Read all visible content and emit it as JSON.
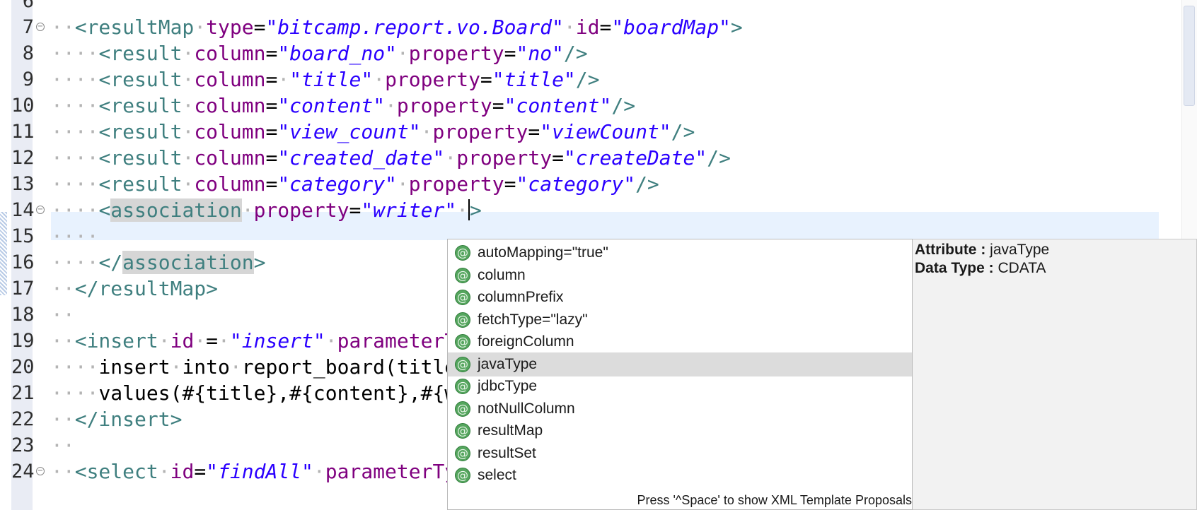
{
  "editor": {
    "lines": [
      {
        "no": "6",
        "fold": false,
        "tokens": []
      },
      {
        "no": "7",
        "fold": true,
        "tokens": [
          [
            "ws",
            "··"
          ],
          [
            "tag",
            "<resultMap"
          ],
          [
            "ws",
            "·"
          ],
          [
            "an",
            "type"
          ],
          [
            "eq",
            "="
          ],
          [
            "av",
            "\"bitcamp.report.vo.Board\""
          ],
          [
            "ws",
            "·"
          ],
          [
            "an",
            "id"
          ],
          [
            "eq",
            "="
          ],
          [
            "av",
            "\"boardMap\""
          ],
          [
            "tag",
            ">"
          ]
        ]
      },
      {
        "no": "8",
        "fold": false,
        "tokens": [
          [
            "ws",
            "····"
          ],
          [
            "tag",
            "<result"
          ],
          [
            "ws",
            "·"
          ],
          [
            "an",
            "column"
          ],
          [
            "eq",
            "="
          ],
          [
            "av",
            "\"board_no\""
          ],
          [
            "ws",
            "·"
          ],
          [
            "an",
            "property"
          ],
          [
            "eq",
            "="
          ],
          [
            "av",
            "\"no\""
          ],
          [
            "tag",
            "/>"
          ]
        ]
      },
      {
        "no": "9",
        "fold": false,
        "tokens": [
          [
            "ws",
            "····"
          ],
          [
            "tag",
            "<result"
          ],
          [
            "ws",
            "·"
          ],
          [
            "an",
            "column"
          ],
          [
            "eq",
            "="
          ],
          [
            "ws",
            "·"
          ],
          [
            "av",
            "\"title\""
          ],
          [
            "ws",
            "·"
          ],
          [
            "an",
            "property"
          ],
          [
            "eq",
            "="
          ],
          [
            "av",
            "\"title\""
          ],
          [
            "tag",
            "/>"
          ]
        ]
      },
      {
        "no": "10",
        "fold": false,
        "tokens": [
          [
            "ws",
            "····"
          ],
          [
            "tag",
            "<result"
          ],
          [
            "ws",
            "·"
          ],
          [
            "an",
            "column"
          ],
          [
            "eq",
            "="
          ],
          [
            "av",
            "\"content\""
          ],
          [
            "ws",
            "·"
          ],
          [
            "an",
            "property"
          ],
          [
            "eq",
            "="
          ],
          [
            "av",
            "\"content\""
          ],
          [
            "tag",
            "/>"
          ]
        ]
      },
      {
        "no": "11",
        "fold": false,
        "tokens": [
          [
            "ws",
            "····"
          ],
          [
            "tag",
            "<result"
          ],
          [
            "ws",
            "·"
          ],
          [
            "an",
            "column"
          ],
          [
            "eq",
            "="
          ],
          [
            "av",
            "\"view_count\""
          ],
          [
            "ws",
            "·"
          ],
          [
            "an",
            "property"
          ],
          [
            "eq",
            "="
          ],
          [
            "av",
            "\"viewCount\""
          ],
          [
            "tag",
            "/>"
          ]
        ]
      },
      {
        "no": "12",
        "fold": false,
        "tokens": [
          [
            "ws",
            "····"
          ],
          [
            "tag",
            "<result"
          ],
          [
            "ws",
            "·"
          ],
          [
            "an",
            "column"
          ],
          [
            "eq",
            "="
          ],
          [
            "av",
            "\"created_date\""
          ],
          [
            "ws",
            "·"
          ],
          [
            "an",
            "property"
          ],
          [
            "eq",
            "="
          ],
          [
            "av",
            "\"createDate\""
          ],
          [
            "tag",
            "/>"
          ]
        ]
      },
      {
        "no": "13",
        "fold": false,
        "tokens": [
          [
            "ws",
            "····"
          ],
          [
            "tag",
            "<result"
          ],
          [
            "ws",
            "·"
          ],
          [
            "an",
            "column"
          ],
          [
            "eq",
            "="
          ],
          [
            "av",
            "\"category\""
          ],
          [
            "ws",
            "·"
          ],
          [
            "an",
            "property"
          ],
          [
            "eq",
            "="
          ],
          [
            "av",
            "\"category\""
          ],
          [
            "tag",
            "/>"
          ]
        ]
      },
      {
        "no": "14",
        "fold": true,
        "tokens": [
          [
            "ws",
            "····"
          ],
          [
            "tag",
            "<"
          ],
          [
            "taghl",
            "association"
          ],
          [
            "ws",
            "·"
          ],
          [
            "an",
            "property"
          ],
          [
            "eq",
            "="
          ],
          [
            "av",
            "\"writer\""
          ],
          [
            "ws",
            "·"
          ],
          [
            "caret",
            ""
          ],
          [
            "tag",
            ">"
          ]
        ]
      },
      {
        "no": "15",
        "fold": false,
        "tokens": [
          [
            "ws",
            "····"
          ]
        ]
      },
      {
        "no": "16",
        "fold": false,
        "tokens": [
          [
            "ws",
            "····"
          ],
          [
            "tag",
            "</"
          ],
          [
            "taghl",
            "association"
          ],
          [
            "tag",
            ">"
          ]
        ]
      },
      {
        "no": "17",
        "fold": false,
        "tokens": [
          [
            "ws",
            "··"
          ],
          [
            "tag",
            "</resultMap>"
          ]
        ]
      },
      {
        "no": "18",
        "fold": false,
        "tokens": [
          [
            "ws",
            "··"
          ]
        ]
      },
      {
        "no": "19",
        "fold": false,
        "tokens": [
          [
            "ws",
            "··"
          ],
          [
            "tag",
            "<insert"
          ],
          [
            "ws",
            "·"
          ],
          [
            "an",
            "id"
          ],
          [
            "ws",
            "·"
          ],
          [
            "eq",
            "="
          ],
          [
            "ws",
            "·"
          ],
          [
            "av",
            "\"insert\""
          ],
          [
            "ws",
            "·"
          ],
          [
            "an",
            "parameterTy"
          ]
        ]
      },
      {
        "no": "20",
        "fold": false,
        "tokens": [
          [
            "ws",
            "····"
          ],
          [
            "eq",
            "insert"
          ],
          [
            "ws",
            "·"
          ],
          [
            "eq",
            "into"
          ],
          [
            "ws",
            "·"
          ],
          [
            "eq",
            "report_board(title,"
          ]
        ]
      },
      {
        "no": "21",
        "fold": false,
        "tokens": [
          [
            "ws",
            "····"
          ],
          [
            "eq",
            "values(#{title},#{content},#{wr"
          ]
        ]
      },
      {
        "no": "22",
        "fold": false,
        "tokens": [
          [
            "ws",
            "··"
          ],
          [
            "tag",
            "</insert>"
          ]
        ]
      },
      {
        "no": "23",
        "fold": false,
        "tokens": [
          [
            "ws",
            "··"
          ]
        ]
      },
      {
        "no": "24",
        "fold": true,
        "tokens": [
          [
            "ws",
            "··"
          ],
          [
            "tag",
            "<select"
          ],
          [
            "ws",
            "·"
          ],
          [
            "an",
            "id"
          ],
          [
            "eq",
            "="
          ],
          [
            "av",
            "\"findAll\""
          ],
          [
            "ws",
            "·"
          ],
          [
            "an",
            "parameterTyp"
          ]
        ]
      }
    ]
  },
  "autocomplete": {
    "icon_glyph": "@",
    "selected_index": 5,
    "items": [
      "autoMapping=\"true\"",
      "column",
      "columnPrefix",
      "fetchType=\"lazy\"",
      "foreignColumn",
      "javaType",
      "jdbcType",
      "notNullColumn",
      "resultMap",
      "resultSet",
      "select"
    ],
    "status_text": "Press '^Space' to show XML Template Proposals"
  },
  "info_panel": {
    "attribute_label": "Attribute :",
    "attribute_value": " javaType",
    "datatype_label": "Data Type :",
    "datatype_value": " CDATA"
  },
  "colors": {
    "tag": "#3f7f7f",
    "attribute_name": "#7f007f",
    "attribute_value": "#2a00ff",
    "current_line": "#e8f2fe",
    "proposal_icon": "#55a55e"
  }
}
